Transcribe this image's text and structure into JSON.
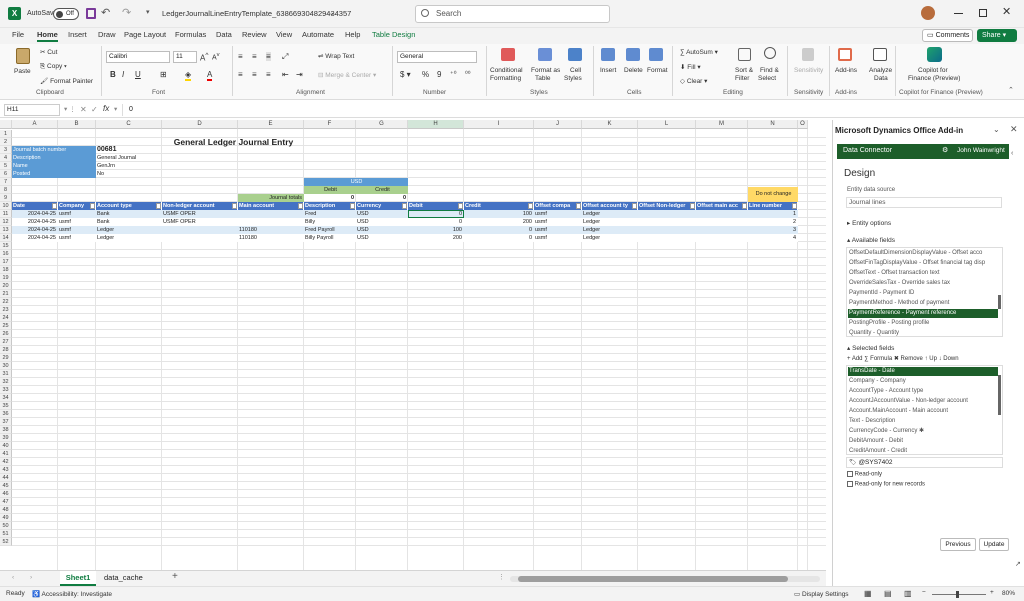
{
  "title": {
    "autosave_label": "AutoSave",
    "autosave_state": "Off",
    "file_name": "LedgerJournalLineEntryTemplate_638669304829434357",
    "search_placeholder": "Search"
  },
  "menu": [
    "File",
    "Home",
    "Insert",
    "Draw",
    "Page Layout",
    "Formulas",
    "Data",
    "Review",
    "View",
    "Automate",
    "Help",
    "Table Design"
  ],
  "menu_right": {
    "comments": "Comments",
    "share": "Share"
  },
  "ribbon": {
    "clipboard": {
      "paste": "Paste",
      "cut": "Cut",
      "copy": "Copy",
      "format_painter": "Format Painter",
      "label": "Clipboard"
    },
    "font": {
      "name": "Calibri",
      "size": "11",
      "label": "Font"
    },
    "alignment": {
      "wrap": "Wrap Text",
      "merge": "Merge & Center",
      "label": "Alignment"
    },
    "number": {
      "format": "General",
      "label": "Number"
    },
    "styles": {
      "conditional": "Conditional",
      "conditional2": "Formatting",
      "format_as": "Format as",
      "format_as2": "Table",
      "cell_styles": "Cell",
      "cell_styles2": "Styles",
      "label": "Styles"
    },
    "cells": {
      "insert": "Insert",
      "delete": "Delete",
      "format": "Format",
      "label": "Cells"
    },
    "editing": {
      "autosum": "AutoSum",
      "fill": "Fill",
      "clear": "Clear",
      "sort": "Sort &",
      "sort2": "Filter",
      "find": "Find &",
      "find2": "Select",
      "label": "Editing"
    },
    "sensitivity": {
      "btn": "Sensitivity",
      "label": "Sensitivity"
    },
    "addins": {
      "btn": "Add-ins",
      "label": "Add-ins"
    },
    "analyze": {
      "btn": "Analyze",
      "btn2": "Data"
    },
    "copilot": {
      "btn": "Copilot for",
      "btn2": "Finance (Preview)",
      "label": "Copilot for Finance (Preview)"
    }
  },
  "formula_bar": {
    "name_box": "H11",
    "fx": "fx",
    "value": "0"
  },
  "columns": [
    "A",
    "B",
    "C",
    "D",
    "E",
    "F",
    "G",
    "H",
    "I",
    "J",
    "K",
    "L",
    "M",
    "N",
    "O"
  ],
  "rows": [
    "1",
    "2",
    "3",
    "4",
    "5",
    "6",
    "7",
    "8",
    "9",
    "10",
    "11",
    "12",
    "13",
    "14",
    "15",
    "16",
    "17",
    "18",
    "19",
    "20",
    "21",
    "22",
    "23",
    "24",
    "25",
    "26",
    "27",
    "28",
    "29",
    "30",
    "31",
    "32",
    "33",
    "34",
    "35",
    "36",
    "37",
    "38",
    "39",
    "40",
    "41",
    "42",
    "43",
    "44",
    "45",
    "46",
    "47",
    "48",
    "49",
    "50",
    "51",
    "52"
  ],
  "sheet": {
    "title": "General Ledger Journal Entry",
    "batch_label": "Journal batch number",
    "batch_value": "00681",
    "desc_label": "Description",
    "desc_value": "General Journal",
    "name_label": "Name",
    "name_value": "GenJrn",
    "posted_label": "Posted",
    "posted_value": "No",
    "currency": "USD",
    "debit": "Debit",
    "credit": "Credit",
    "totals_label": "Journal totals",
    "total_debit": "0",
    "total_credit": "0",
    "do_not_change": "Do not change",
    "headers": [
      "Date",
      "Company",
      "Account type",
      "Non-ledger account",
      "Main account",
      "Description",
      "Currency",
      "Debit",
      "Credit",
      "Offset compa",
      "Offset account ty",
      "Offset Non-ledger",
      "Offset main acc",
      "Line number"
    ],
    "data": [
      [
        "2024-04-25",
        "usmf",
        "Bank",
        "USMF OPER",
        "",
        "Fred",
        "USD",
        "0",
        "100",
        "usmf",
        "Ledger",
        "",
        "",
        "1"
      ],
      [
        "2024-04-25",
        "usmf",
        "Bank",
        "USMF OPER",
        "",
        "Billy",
        "USD",
        "0",
        "200",
        "usmf",
        "Ledger",
        "",
        "",
        "2"
      ],
      [
        "2024-04-25",
        "usmf",
        "Ledger",
        "",
        "110180",
        "Fred Payroll",
        "USD",
        "100",
        "0",
        "usmf",
        "Ledger",
        "",
        "",
        "3"
      ],
      [
        "2024-04-25",
        "usmf",
        "Ledger",
        "",
        "110180",
        "Billy Payroll",
        "USD",
        "200",
        "0",
        "usmf",
        "Ledger",
        "",
        "",
        "4"
      ]
    ]
  },
  "tabs": {
    "sheet1": "Sheet1",
    "data_cache": "data_cache"
  },
  "status": {
    "ready": "Ready",
    "accessibility": "Accessibility: Investigate",
    "display": "Display Settings",
    "zoom": "80%"
  },
  "pane": {
    "title": "Microsoft Dynamics Office Add-in",
    "connector": "Data Connector",
    "user": "John Wainwright",
    "design": "Design",
    "source_label": "Entity data source",
    "source_value": "Journal lines",
    "entity_options": "Entity options",
    "available_fields": "Available fields",
    "available": [
      "OffsetDefaultDimensionDisplayValue - Offset acco",
      "OffsetFinTagDisplayValue - Offset financial tag disp",
      "OffsetText - Offset transaction text",
      "OverrideSalesTax - Override sales tax",
      "PaymentId - Payment ID",
      "PaymentMethod - Method of payment",
      "PaymentReference - Payment reference",
      "PostingProfile - Posting profile",
      "Quantity - Quantity"
    ],
    "selected_fields": "Selected fields",
    "actions": {
      "add": "Add",
      "formula": "Formula",
      "remove": "Remove",
      "up": "Up",
      "down": "Down"
    },
    "selected": [
      "TransDate - Date",
      "Company - Company",
      "AccountType - Account type",
      "AccountJAccountValue - Non-ledger account",
      "Account.MainAccount - Main account",
      "Text - Description",
      "CurrencyCode - Currency",
      "DebitAmount - Debit",
      "CreditAmount - Credit"
    ],
    "label_field": "@SYS7402",
    "read_only": "Read-only",
    "read_only_new": "Read-only for new records",
    "previous": "Previous",
    "update": "Update"
  }
}
